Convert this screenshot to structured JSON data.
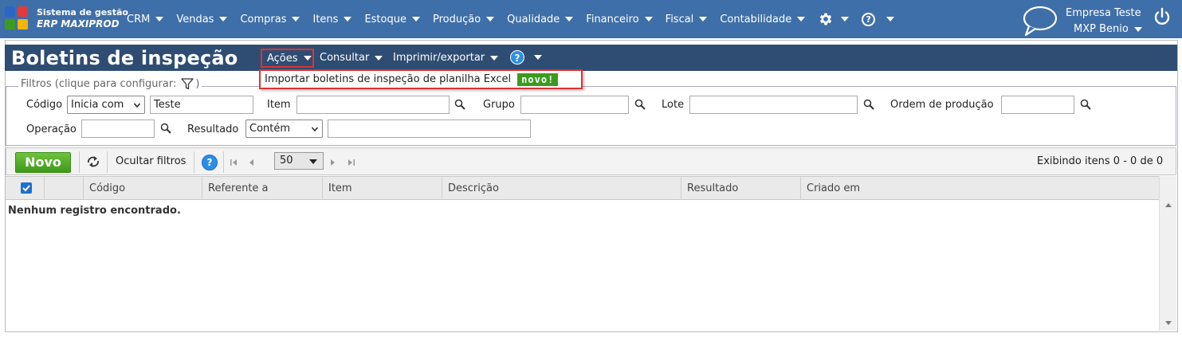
{
  "colors": {
    "topbar": "#3f6fa8",
    "pagehead": "#2f4d73",
    "accent_green": "#3e9a1a",
    "highlight_red": "#dd3333",
    "help_blue": "#2e8fe0"
  },
  "app": {
    "logo_line1": "Sistema de gestão",
    "logo_line2": "ERP MAXIPROD"
  },
  "nav": {
    "items": [
      "CRM",
      "Vendas",
      "Compras",
      "Itens",
      "Estoque",
      "Produção",
      "Qualidade",
      "Financeiro",
      "Fiscal",
      "Contabilidade"
    ],
    "icons": [
      "gear-icon",
      "help-icon",
      "chat-icon",
      "power-icon"
    ]
  },
  "user": {
    "company": "Empresa Teste",
    "user_name": "MXP Benio"
  },
  "page": {
    "title": "Boletins de inspeção",
    "submenus": {
      "acoes": "Ações",
      "consultar": "Consultar",
      "imprimir": "Imprimir/exportar"
    }
  },
  "dropdown": {
    "item_label": "Importar boletins de inspeção de planilha Excel",
    "badge": "novo!"
  },
  "filters": {
    "legend": "Filtros (clique para configurar:",
    "legend_close": ")",
    "codigo_label": "Código",
    "codigo_mode": "Inicia com",
    "codigo_value": "Teste",
    "item_label": "Item",
    "grupo_label": "Grupo",
    "lote_label": "Lote",
    "ordem_label": "Ordem de produção",
    "operacao_label": "Operação",
    "resultado_label": "Resultado",
    "resultado_mode": "Contém"
  },
  "toolbar": {
    "new_label": "Novo",
    "hide_filters_label": "Ocultar filtros",
    "page_size": "50",
    "showing_text": "Exibindo itens 0 - 0 de 0"
  },
  "grid": {
    "columns": [
      "Código",
      "Referente a",
      "Item",
      "Descrição",
      "Resultado",
      "Criado em"
    ],
    "empty_message": "Nenhum registro encontrado."
  }
}
